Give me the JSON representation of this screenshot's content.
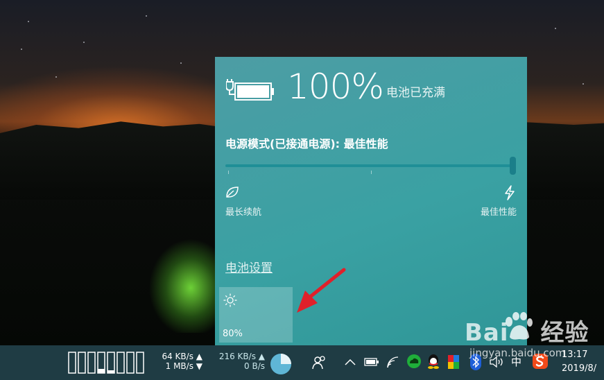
{
  "battery": {
    "percent": "100%",
    "status": "电池已充满",
    "mode_title": "电源模式(已接通电源): 最佳性能",
    "slider_level": 1.0,
    "min_label": "最长续航",
    "max_label": "最佳性能",
    "settings_link": "电池设置"
  },
  "quick_action": {
    "icon": "brightness-icon",
    "value": "80%"
  },
  "taskbar": {
    "net_up_1": "64 KB/s ▲",
    "net_down_1": "1 MB/s ▼",
    "net_up_2": "216 KB/s ▲",
    "net_down_2": "0 B/s",
    "ime": "中",
    "time": "13:17",
    "date": "2019/8/"
  },
  "watermark": {
    "brand": "Bai",
    "brand2": "经验",
    "url": "jingyan.baidu.com"
  },
  "colors": {
    "flyout": "#3aa1a3",
    "taskbar": "#1f3c44",
    "accent": "#1b7f8a",
    "arrow": "#e0202a"
  }
}
